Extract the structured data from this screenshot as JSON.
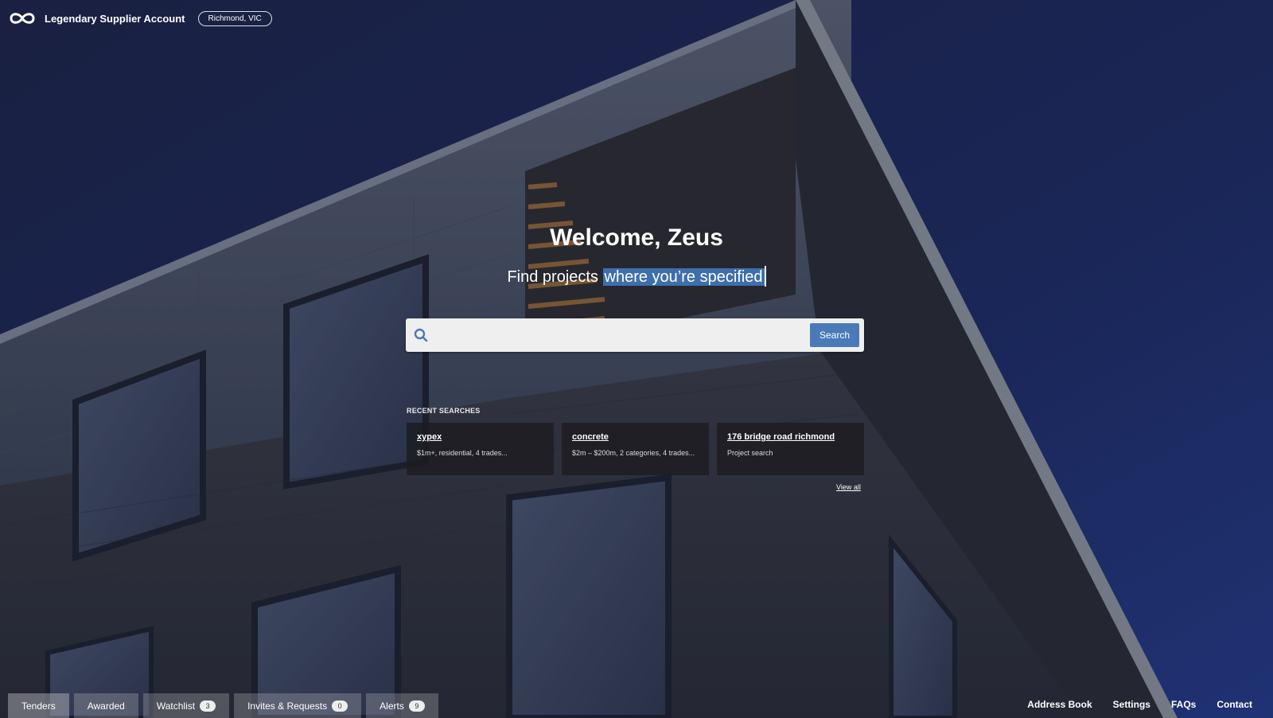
{
  "header": {
    "account_name": "Legendary Supplier Account",
    "location": "Richmond, VIC"
  },
  "hero": {
    "welcome": "Welcome, Zeus",
    "subtitle_prefix": "Find projects",
    "subtitle_highlight": "where you’re specified"
  },
  "search": {
    "value": "",
    "button_label": "Search"
  },
  "recent": {
    "label": "RECENT SEARCHES",
    "items": [
      {
        "title": "xypex",
        "desc": "$1m+, residential, 4 trades..."
      },
      {
        "title": "concrete",
        "desc": "$2m – $200m, 2 categories, 4 trades..."
      },
      {
        "title": "176 bridge road richmond",
        "desc": "Project search"
      }
    ],
    "view_all": "View all"
  },
  "tabs": [
    {
      "label": "Tenders",
      "badge": null
    },
    {
      "label": "Awarded",
      "badge": null
    },
    {
      "label": "Watchlist",
      "badge": "3"
    },
    {
      "label": "Invites & Requests",
      "badge": "0"
    },
    {
      "label": "Alerts",
      "badge": "9"
    }
  ],
  "footer_links": [
    "Address Book",
    "Settings",
    "FAQs",
    "Contact"
  ],
  "icons": {
    "logo": "infinity-logo-icon",
    "search": "search-icon"
  },
  "colors": {
    "sky": "#1f2a5a",
    "search_button": "#4a7bb8",
    "highlight": "#3f6fab",
    "card_bg": "#1c1c20"
  }
}
